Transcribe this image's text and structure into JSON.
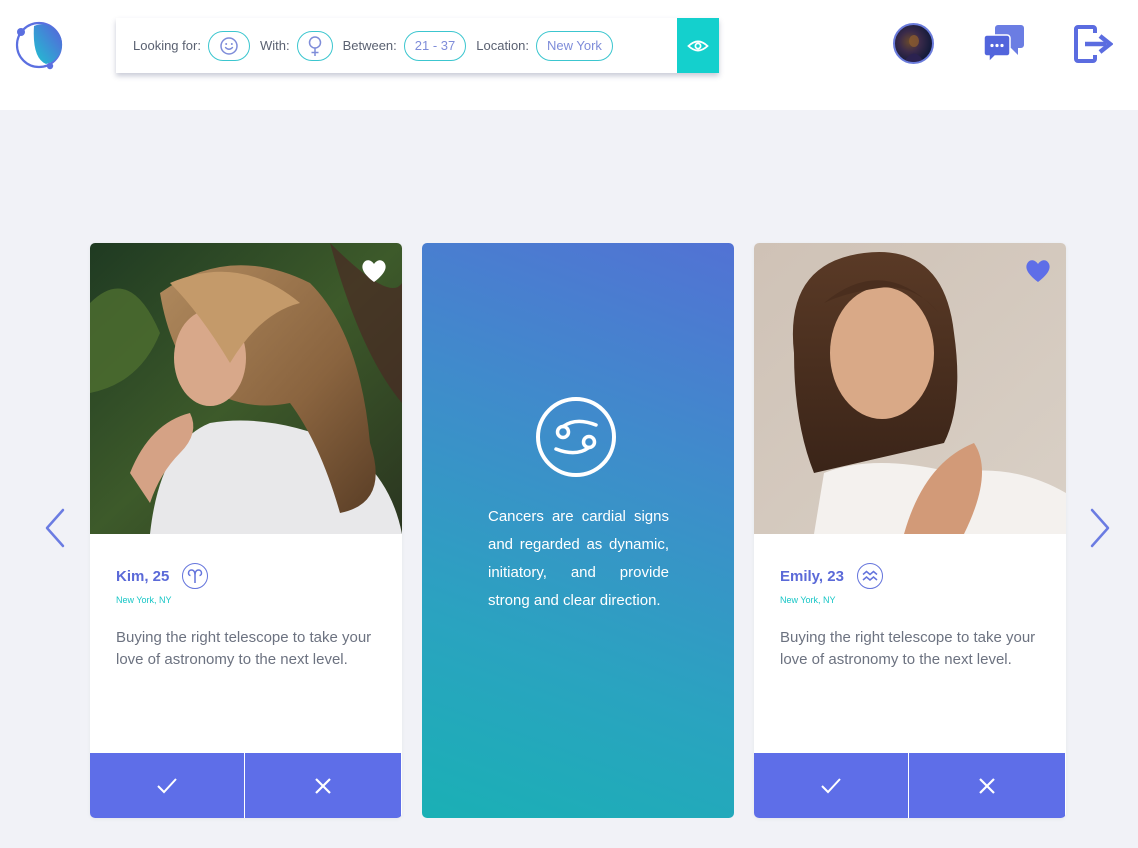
{
  "filter": {
    "looking_for_label": "Looking for:",
    "with_label": "With:",
    "between_label": "Between:",
    "age_range": "21 - 37",
    "location_label": "Location:",
    "location_value": "New York",
    "looking_for_icon": "smiley-icon",
    "with_icon": "female-symbol-icon",
    "apply_icon": "eye-icon"
  },
  "header_icons": [
    "avatar",
    "chat-icon",
    "logout-icon"
  ],
  "carousel": {
    "prev_icon": "chevron-left-icon",
    "next_icon": "chevron-right-icon"
  },
  "cards": [
    {
      "name": "Kim, 25",
      "zodiac_icon": "aries-icon",
      "location": "New York, NY",
      "bio": "Buying the right telescope to take your love of astronomy to the next level.",
      "heart_state": "outline-white",
      "accept_icon": "check-icon",
      "reject_icon": "close-icon"
    },
    {
      "name": "Emily, 23",
      "zodiac_icon": "aquarius-icon",
      "location": "New York, NY",
      "bio": "Buying the right telescope to take your love of astronomy to the next level.",
      "heart_state": "filled-blue",
      "accept_icon": "check-icon",
      "reject_icon": "close-icon"
    }
  ],
  "info_card": {
    "icon": "cancer-icon",
    "text": "Cancers are cardial signs and regarded as dynamic, initiatory, and provide strong and clear direction."
  },
  "colors": {
    "accent": "#5e6ee8",
    "teal": "#14d0cd",
    "name_blue": "#5b6ad8",
    "location_teal": "#17c6c6",
    "background": "#f1f2f7"
  }
}
